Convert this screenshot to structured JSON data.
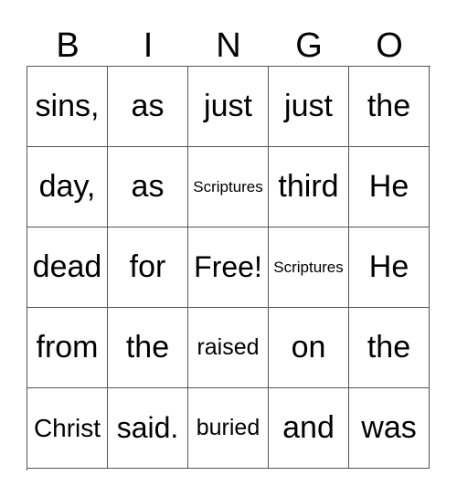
{
  "header": [
    "B",
    "I",
    "N",
    "G",
    "O"
  ],
  "cells": [
    [
      "sins,",
      "as",
      "just",
      "just",
      "the"
    ],
    [
      "day,",
      "as",
      "Scriptures",
      "third",
      "He"
    ],
    [
      "dead",
      "for",
      "Free!",
      "Scriptures",
      "He"
    ],
    [
      "from",
      "the",
      "raised",
      "on",
      "the"
    ],
    [
      "Christ",
      "said.",
      "buried",
      "and",
      "was"
    ]
  ]
}
